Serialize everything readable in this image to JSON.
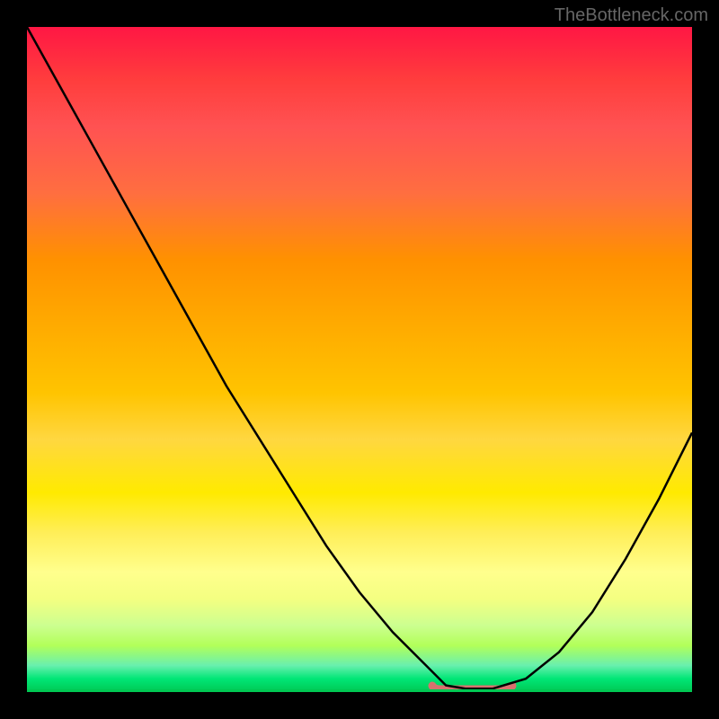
{
  "watermark": "TheBottleneck.com",
  "chart_data": {
    "type": "line",
    "title": "",
    "xlabel": "",
    "ylabel": "",
    "x": [
      0,
      5,
      10,
      15,
      20,
      25,
      30,
      35,
      40,
      45,
      50,
      55,
      60,
      63,
      66,
      70,
      75,
      80,
      85,
      90,
      95,
      100
    ],
    "values": [
      100,
      91,
      82,
      73,
      64,
      55,
      46,
      38,
      30,
      22,
      15,
      9,
      4,
      1,
      0.5,
      0.5,
      2,
      6,
      12,
      20,
      29,
      39
    ],
    "ylim": [
      0,
      100
    ],
    "xlim": [
      0,
      100
    ],
    "optimal_zone": {
      "start": 61,
      "end": 73,
      "color": "#d9716e"
    },
    "background_gradient": {
      "type": "vertical",
      "stops": [
        {
          "pos": 0,
          "color": "#ff1744"
        },
        {
          "pos": 50,
          "color": "#ffc400"
        },
        {
          "pos": 80,
          "color": "#ffff8d"
        },
        {
          "pos": 100,
          "color": "#00c853"
        }
      ]
    }
  }
}
